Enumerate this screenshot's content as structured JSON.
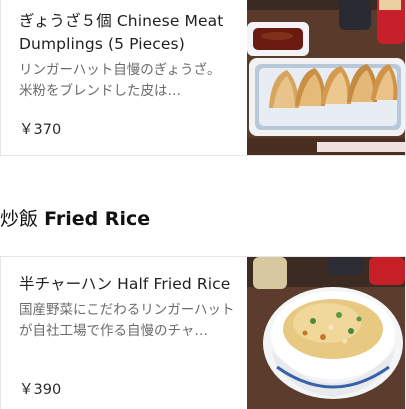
{
  "colors": {
    "text_primary": "#1f1f1f",
    "text_secondary": "#6b6b6b",
    "border": "#e6e6e6"
  },
  "items": [
    {
      "name": "ぎょうざ５個 Chinese Meat Dumplings (5 Pieces)",
      "description": "リンガーハット自慢のぎょうざ。　米粉をブレンドした皮は…",
      "price": "￥370",
      "image": "gyoza-photo"
    },
    {
      "name": "半チャーハン Half Fried Rice",
      "description": "国産野菜にこだわるリンガーハットが自社工場で作る自慢のチャ…",
      "price": "￥390",
      "image": "fried-rice-photo"
    }
  ],
  "section": {
    "title_jp": "炒飯",
    "title_en": "Fried Rice"
  }
}
